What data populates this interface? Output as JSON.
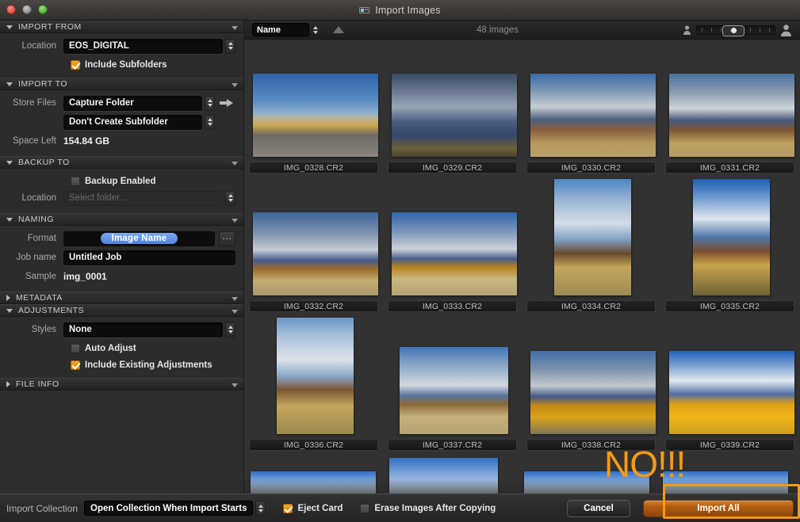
{
  "window": {
    "title": "Import Images",
    "title_icon": "camera-card-icon",
    "traffic_lights": [
      "close",
      "minimize",
      "zoom"
    ]
  },
  "sidebar": {
    "sections": [
      {
        "id": "import-from",
        "label": "IMPORT FROM",
        "expanded": true,
        "rows": [
          {
            "type": "select",
            "label": "Location",
            "value": "EOS_DIGITAL"
          },
          {
            "type": "checkbox",
            "label": "Include Subfolders",
            "checked": true
          }
        ]
      },
      {
        "id": "import-to",
        "label": "IMPORT TO",
        "expanded": true,
        "rows": [
          {
            "type": "select-arrow",
            "label": "Store Files",
            "value": "Capture Folder"
          },
          {
            "type": "select",
            "label": "",
            "value": "Don't Create Subfolder"
          },
          {
            "type": "static",
            "label": "Space Left",
            "value": "154.84 GB"
          }
        ]
      },
      {
        "id": "backup-to",
        "label": "BACKUP TO",
        "expanded": true,
        "rows": [
          {
            "type": "checkbox",
            "label": "Backup Enabled",
            "checked": false
          },
          {
            "type": "select-empty",
            "label": "Location",
            "value": "Select folder..."
          }
        ]
      },
      {
        "id": "naming",
        "label": "NAMING",
        "expanded": true,
        "rows": [
          {
            "type": "token",
            "label": "Format",
            "value": "Image Name",
            "button": "..."
          },
          {
            "type": "text",
            "label": "Job name",
            "value": "Untitled Job"
          },
          {
            "type": "static",
            "label": "Sample",
            "value": "img_0001"
          }
        ]
      },
      {
        "id": "metadata",
        "label": "METADATA",
        "expanded": false,
        "rows": []
      },
      {
        "id": "adjustments",
        "label": "ADJUSTMENTS",
        "expanded": true,
        "rows": [
          {
            "type": "select",
            "label": "Styles",
            "value": "None"
          },
          {
            "type": "checkbox",
            "label": "Auto Adjust",
            "checked": false
          },
          {
            "type": "checkbox",
            "label": "Include Existing Adjustments",
            "checked": true
          }
        ]
      },
      {
        "id": "file-info",
        "label": "FILE INFO",
        "expanded": false,
        "rows": []
      }
    ]
  },
  "toolbar": {
    "sort_value": "Name",
    "sort_direction_icon": "sort-ascending-icon",
    "image_count": "48 images",
    "zoom_small_icon": "person-small-icon",
    "zoom_large_icon": "person-large-icon",
    "zoom_position_percent": 34
  },
  "browser": {
    "thumbnails": [
      {
        "file": "IMG_0328.CR2",
        "orientation": "landscape",
        "scene": "gate-road"
      },
      {
        "file": "IMG_0329.CR2",
        "orientation": "landscape",
        "scene": "mountain-clouds"
      },
      {
        "file": "IMG_0330.CR2",
        "orientation": "landscape",
        "scene": "barn-left"
      },
      {
        "file": "IMG_0331.CR2",
        "orientation": "landscape",
        "scene": "barn-right"
      },
      {
        "file": "IMG_0332.CR2",
        "orientation": "landscape",
        "scene": "barn-trees"
      },
      {
        "file": "IMG_0333.CR2",
        "orientation": "landscape",
        "scene": "trees-field"
      },
      {
        "file": "IMG_0334.CR2",
        "orientation": "portrait",
        "scene": "barn-vertical"
      },
      {
        "file": "IMG_0335.CR2",
        "orientation": "portrait",
        "scene": "barn-vertical-blue"
      },
      {
        "file": "IMG_0336.CR2",
        "orientation": "portrait",
        "scene": "barn-tall"
      },
      {
        "file": "IMG_0337.CR2",
        "orientation": "square",
        "scene": "barn-wide-field"
      },
      {
        "file": "IMG_0338.CR2",
        "orientation": "landscape",
        "scene": "autumn-trees-mountain"
      },
      {
        "file": "IMG_0339.CR2",
        "orientation": "landscape",
        "scene": "teton-autumn"
      }
    ]
  },
  "bottom_bar": {
    "import_collection_label": "Import Collection",
    "import_collection_value": "Open Collection When Import Starts",
    "eject_card_label": "Eject Card",
    "eject_card_checked": true,
    "erase_images_label": "Erase Images After Copying",
    "erase_images_checked": false,
    "cancel_label": "Cancel",
    "import_all_label": "Import All"
  },
  "annotations": {
    "no_text": "NO!!!",
    "highlight_color": "#f59a11"
  }
}
